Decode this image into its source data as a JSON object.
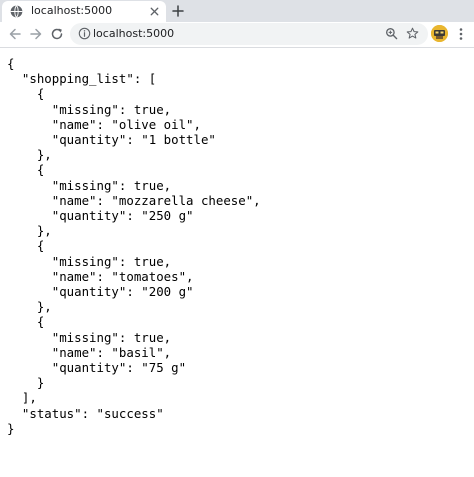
{
  "browser": {
    "tab_title": "localhost:5000",
    "url": "localhost:5000",
    "accent_color": "#e9b62f"
  },
  "icons": {
    "tab_favicon": "globe-icon",
    "tab_close": "close-icon",
    "new_tab": "plus-icon",
    "back": "arrow-left-icon",
    "forward": "arrow-right-icon",
    "reload": "reload-icon",
    "site_info": "info-icon",
    "zoom": "zoom-icon",
    "bookmark": "star-icon",
    "profile": "avatar-icon",
    "menu": "kebab-menu-icon"
  },
  "json_text": "{\n  \"shopping_list\": [\n    {\n      \"missing\": true,\n      \"name\": \"olive oil\",\n      \"quantity\": \"1 bottle\"\n    },\n    {\n      \"missing\": true,\n      \"name\": \"mozzarella cheese\",\n      \"quantity\": \"250 g\"\n    },\n    {\n      \"missing\": true,\n      \"name\": \"tomatoes\",\n      \"quantity\": \"200 g\"\n    },\n    {\n      \"missing\": true,\n      \"name\": \"basil\",\n      \"quantity\": \"75 g\"\n    }\n  ],\n  \"status\": \"success\"\n}"
}
